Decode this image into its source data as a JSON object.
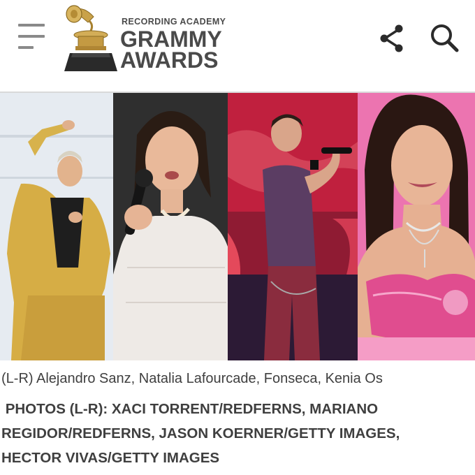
{
  "header": {
    "menu_icon": "hamburger-menu-icon",
    "logo": {
      "tagline": "RECORDING ACADEMY",
      "line1": "GRAMMY",
      "line2": "AWARDS"
    },
    "share_icon": "share-icon",
    "search_icon": "search-icon"
  },
  "photos": [
    {
      "subject": "Alejandro Sanz"
    },
    {
      "subject": "Natalia Lafourcade"
    },
    {
      "subject": "Fonseca"
    },
    {
      "subject": "Kenia Os"
    }
  ],
  "caption": "(L-R) Alejandro Sanz, Natalia Lafourcade, Fonseca, Kenia Os",
  "credits": {
    "line1": " PHOTOS (L-R): XACI TORRENT/REDFERNS, MARIANO",
    "line2": "REGIDOR/REDFERNS, JASON KOERNER/GETTY IMAGES,",
    "line3": "HECTOR VIVAS/GETTY IMAGES"
  },
  "colors": {
    "text": "#3f3f3f",
    "logo": "#4a4a4a",
    "gold": "#c9a24a"
  }
}
